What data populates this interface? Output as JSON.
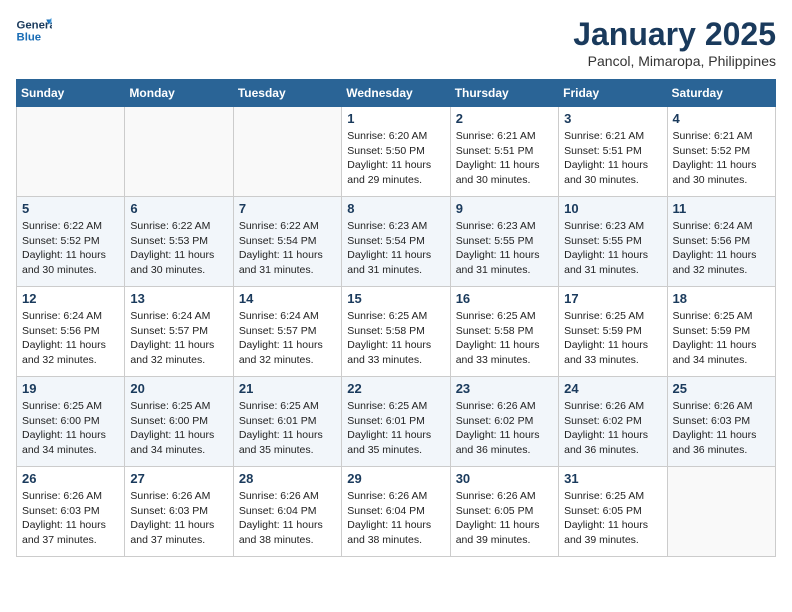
{
  "header": {
    "logo_line1": "General",
    "logo_line2": "Blue",
    "title": "January 2025",
    "subtitle": "Pancol, Mimaropa, Philippines"
  },
  "weekdays": [
    "Sunday",
    "Monday",
    "Tuesday",
    "Wednesday",
    "Thursday",
    "Friday",
    "Saturday"
  ],
  "weeks": [
    [
      {
        "day": null
      },
      {
        "day": null
      },
      {
        "day": null
      },
      {
        "day": "1",
        "sunrise": "6:20 AM",
        "sunset": "5:50 PM",
        "daylight": "11 hours and 29 minutes."
      },
      {
        "day": "2",
        "sunrise": "6:21 AM",
        "sunset": "5:51 PM",
        "daylight": "11 hours and 30 minutes."
      },
      {
        "day": "3",
        "sunrise": "6:21 AM",
        "sunset": "5:51 PM",
        "daylight": "11 hours and 30 minutes."
      },
      {
        "day": "4",
        "sunrise": "6:21 AM",
        "sunset": "5:52 PM",
        "daylight": "11 hours and 30 minutes."
      }
    ],
    [
      {
        "day": "5",
        "sunrise": "6:22 AM",
        "sunset": "5:52 PM",
        "daylight": "11 hours and 30 minutes."
      },
      {
        "day": "6",
        "sunrise": "6:22 AM",
        "sunset": "5:53 PM",
        "daylight": "11 hours and 30 minutes."
      },
      {
        "day": "7",
        "sunrise": "6:22 AM",
        "sunset": "5:54 PM",
        "daylight": "11 hours and 31 minutes."
      },
      {
        "day": "8",
        "sunrise": "6:23 AM",
        "sunset": "5:54 PM",
        "daylight": "11 hours and 31 minutes."
      },
      {
        "day": "9",
        "sunrise": "6:23 AM",
        "sunset": "5:55 PM",
        "daylight": "11 hours and 31 minutes."
      },
      {
        "day": "10",
        "sunrise": "6:23 AM",
        "sunset": "5:55 PM",
        "daylight": "11 hours and 31 minutes."
      },
      {
        "day": "11",
        "sunrise": "6:24 AM",
        "sunset": "5:56 PM",
        "daylight": "11 hours and 32 minutes."
      }
    ],
    [
      {
        "day": "12",
        "sunrise": "6:24 AM",
        "sunset": "5:56 PM",
        "daylight": "11 hours and 32 minutes."
      },
      {
        "day": "13",
        "sunrise": "6:24 AM",
        "sunset": "5:57 PM",
        "daylight": "11 hours and 32 minutes."
      },
      {
        "day": "14",
        "sunrise": "6:24 AM",
        "sunset": "5:57 PM",
        "daylight": "11 hours and 32 minutes."
      },
      {
        "day": "15",
        "sunrise": "6:25 AM",
        "sunset": "5:58 PM",
        "daylight": "11 hours and 33 minutes."
      },
      {
        "day": "16",
        "sunrise": "6:25 AM",
        "sunset": "5:58 PM",
        "daylight": "11 hours and 33 minutes."
      },
      {
        "day": "17",
        "sunrise": "6:25 AM",
        "sunset": "5:59 PM",
        "daylight": "11 hours and 33 minutes."
      },
      {
        "day": "18",
        "sunrise": "6:25 AM",
        "sunset": "5:59 PM",
        "daylight": "11 hours and 34 minutes."
      }
    ],
    [
      {
        "day": "19",
        "sunrise": "6:25 AM",
        "sunset": "6:00 PM",
        "daylight": "11 hours and 34 minutes."
      },
      {
        "day": "20",
        "sunrise": "6:25 AM",
        "sunset": "6:00 PM",
        "daylight": "11 hours and 34 minutes."
      },
      {
        "day": "21",
        "sunrise": "6:25 AM",
        "sunset": "6:01 PM",
        "daylight": "11 hours and 35 minutes."
      },
      {
        "day": "22",
        "sunrise": "6:25 AM",
        "sunset": "6:01 PM",
        "daylight": "11 hours and 35 minutes."
      },
      {
        "day": "23",
        "sunrise": "6:26 AM",
        "sunset": "6:02 PM",
        "daylight": "11 hours and 36 minutes."
      },
      {
        "day": "24",
        "sunrise": "6:26 AM",
        "sunset": "6:02 PM",
        "daylight": "11 hours and 36 minutes."
      },
      {
        "day": "25",
        "sunrise": "6:26 AM",
        "sunset": "6:03 PM",
        "daylight": "11 hours and 36 minutes."
      }
    ],
    [
      {
        "day": "26",
        "sunrise": "6:26 AM",
        "sunset": "6:03 PM",
        "daylight": "11 hours and 37 minutes."
      },
      {
        "day": "27",
        "sunrise": "6:26 AM",
        "sunset": "6:03 PM",
        "daylight": "11 hours and 37 minutes."
      },
      {
        "day": "28",
        "sunrise": "6:26 AM",
        "sunset": "6:04 PM",
        "daylight": "11 hours and 38 minutes."
      },
      {
        "day": "29",
        "sunrise": "6:26 AM",
        "sunset": "6:04 PM",
        "daylight": "11 hours and 38 minutes."
      },
      {
        "day": "30",
        "sunrise": "6:26 AM",
        "sunset": "6:05 PM",
        "daylight": "11 hours and 39 minutes."
      },
      {
        "day": "31",
        "sunrise": "6:25 AM",
        "sunset": "6:05 PM",
        "daylight": "11 hours and 39 minutes."
      },
      {
        "day": null
      }
    ]
  ]
}
